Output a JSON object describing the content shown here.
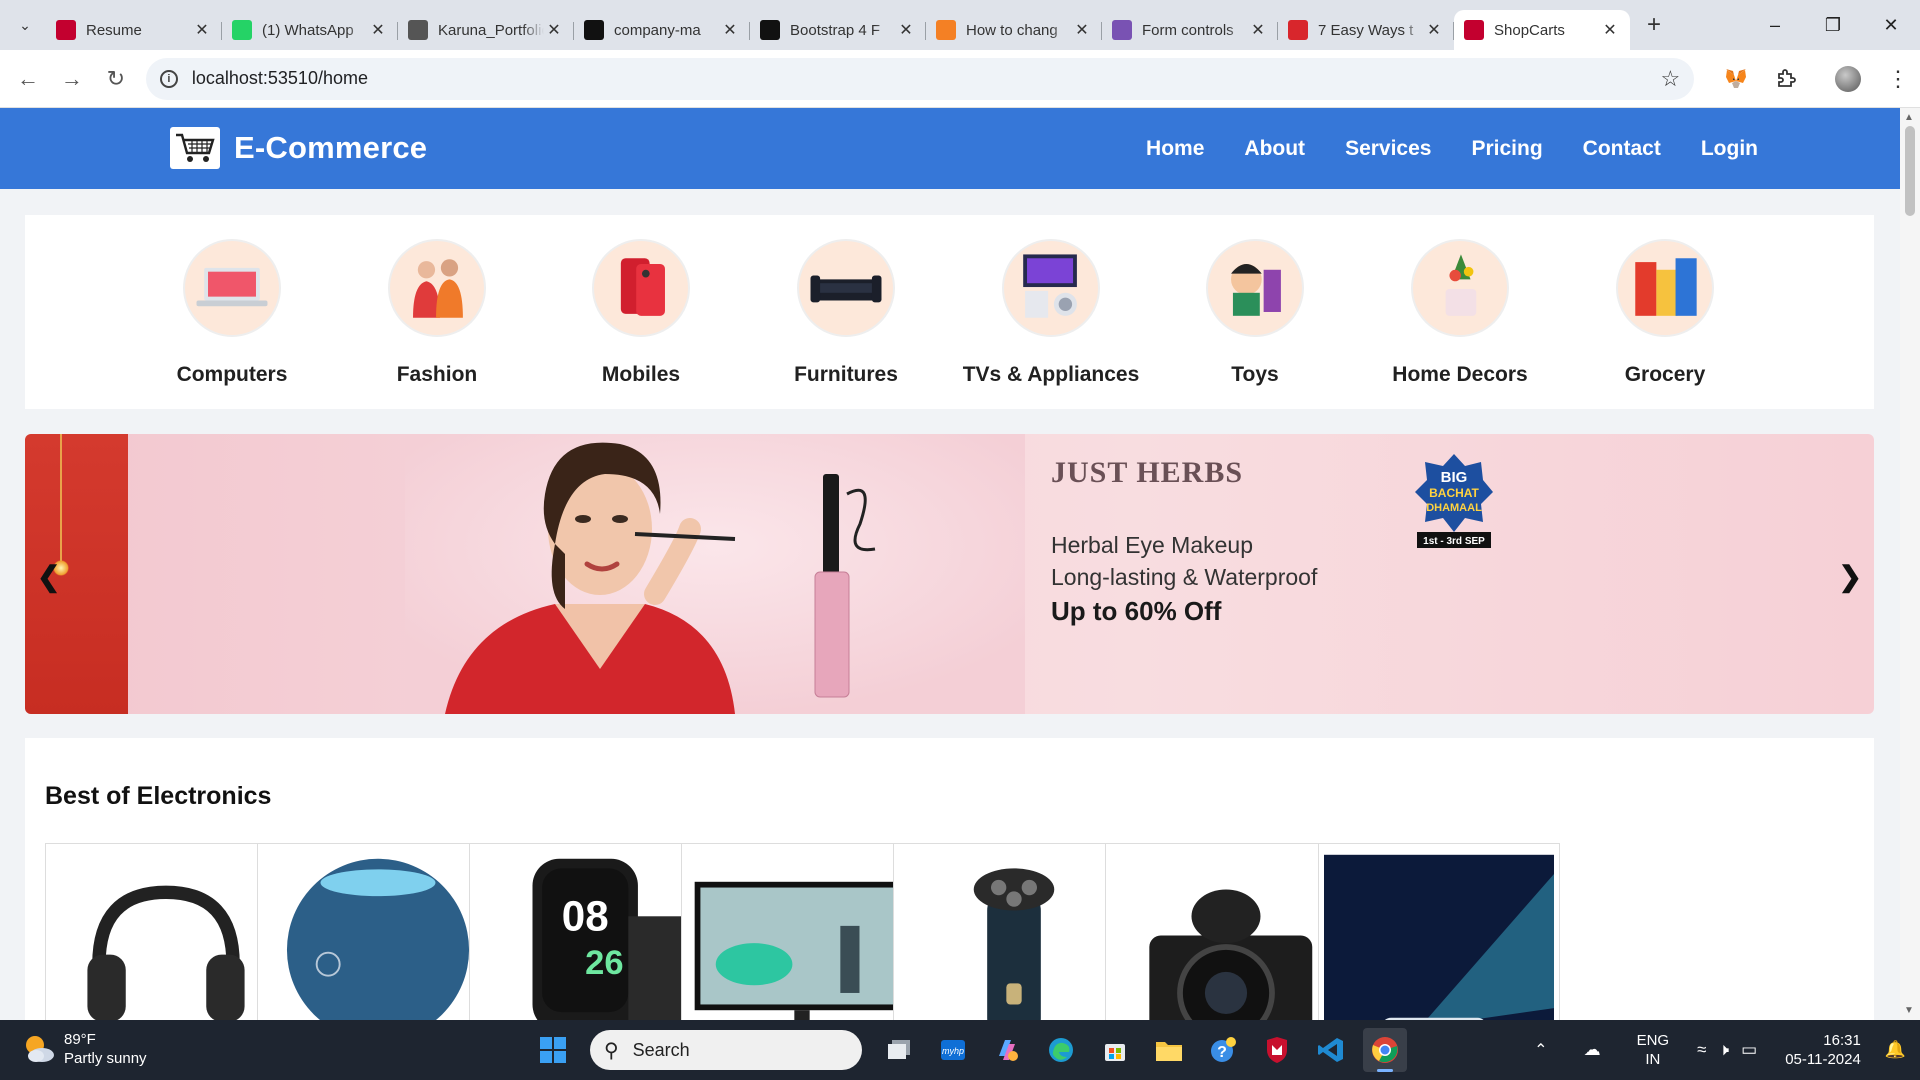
{
  "browser": {
    "tabs": [
      {
        "title": "Resume",
        "favicon": "angular-icon",
        "color": "#c3002f"
      },
      {
        "title": "(1) WhatsApp",
        "favicon": "whatsapp-icon",
        "color": "#25d366"
      },
      {
        "title": "Karuna_Portfolio",
        "favicon": "portfolio-icon",
        "color": "#555555"
      },
      {
        "title": "company-ma",
        "favicon": "github-icon",
        "color": "#111111"
      },
      {
        "title": "Bootstrap 4 F",
        "favicon": "codeply-icon",
        "color": "#111111"
      },
      {
        "title": "How to chang",
        "favicon": "stackoverflow-icon",
        "color": "#f48024"
      },
      {
        "title": "Form controls",
        "favicon": "bootstrap-icon",
        "color": "#7952b3"
      },
      {
        "title": "7 Easy Ways t",
        "favicon": "pcmag-icon",
        "color": "#d8262c"
      },
      {
        "title": "ShopCarts",
        "favicon": "angular-icon",
        "color": "#c3002f",
        "active": true
      }
    ],
    "url": "localhost:53510/home"
  },
  "site": {
    "brand": "E-Commerce",
    "nav": [
      "Home",
      "About",
      "Services",
      "Pricing",
      "Contact",
      "Login"
    ],
    "categories": [
      "Computers",
      "Fashion",
      "Mobiles",
      "Furnitures",
      "TVs & Appliances",
      "Toys",
      "Home Decors",
      "Grocery"
    ],
    "banner": {
      "brand": "JUST HERBS",
      "line1": "Herbal Eye Makeup",
      "line2": "Long-lasting & Waterproof",
      "offer": "Up to 60% Off",
      "badge_line1": "BIG",
      "badge_line2": "BACHAT",
      "badge_line3": "DHAMAAL",
      "badge_dates": "1st - 3rd SEP"
    },
    "section_title": "Best of Electronics",
    "products": [
      "headphones",
      "speaker",
      "smartwatch",
      "monitor",
      "trimmer",
      "camera",
      "projector"
    ]
  },
  "taskbar": {
    "temp": "89°F",
    "weather": "Partly sunny",
    "search": "Search",
    "lang1": "ENG",
    "lang2": "IN",
    "time": "16:31",
    "date": "05-11-2024"
  }
}
